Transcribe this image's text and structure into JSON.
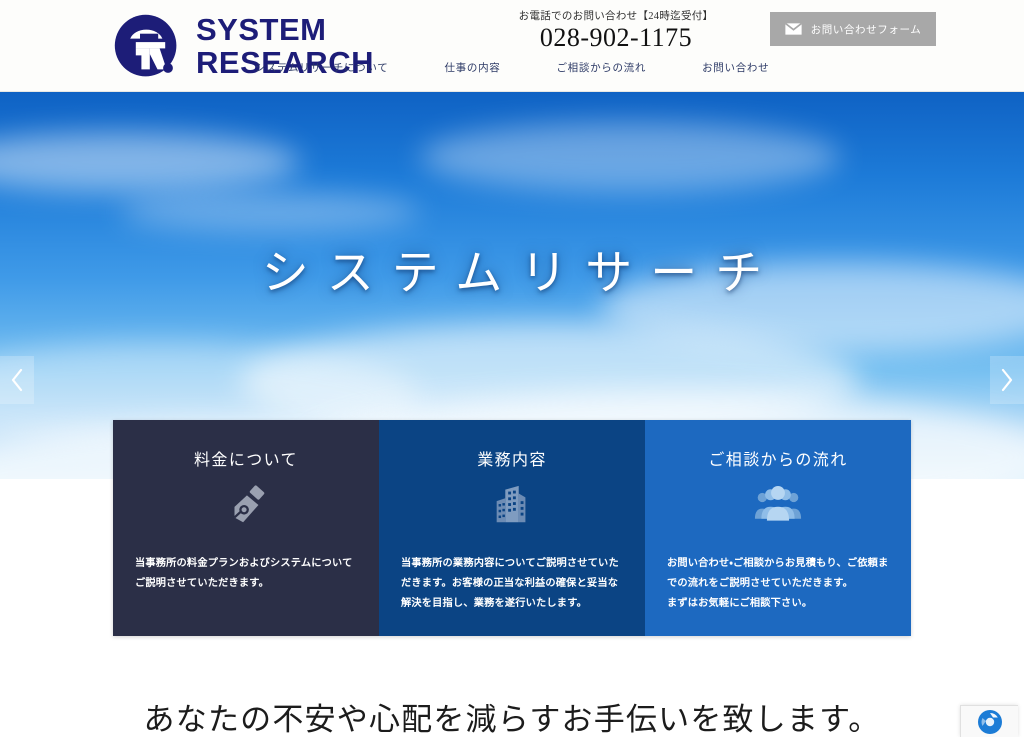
{
  "site": {
    "logo_line1": "SYSTEM",
    "logo_line2": "RESEARCH",
    "logo_icon": "sr-monogram-icon"
  },
  "header": {
    "contact_label": "お電話でのお問い合わせ【24時迄受付】",
    "phone": "028-902-1175",
    "contact_button": "お問い合わせフォーム",
    "mail_icon": "envelope-icon",
    "nav": [
      {
        "label": "システムリサーチについて"
      },
      {
        "label": "仕事の内容"
      },
      {
        "label": "ご相談からの流れ"
      },
      {
        "label": "お問い合わせ"
      }
    ]
  },
  "hero": {
    "title": "システムリサーチ",
    "prev_icon": "chevron-left-icon",
    "next_icon": "chevron-right-icon"
  },
  "cards": [
    {
      "title": "料金について",
      "icon": "fountain-pen-nib-icon",
      "body": "当事務所の料金プランおよびシステムについてご説明させていただきます。",
      "color": "#2b2f47"
    },
    {
      "title": "業務内容",
      "icon": "office-building-icon",
      "body": "当事務所の業務内容についてご説明させていただきます。お客様の正当な利益の確保と妥当な解決を目指し、業務を遂行いたします。",
      "color": "#0b4484"
    },
    {
      "title": "ご相談からの流れ",
      "icon": "people-group-icon",
      "body": "お問い合わせ・ご相談からお見積もり、ご依頼までの流れをご説明させていただきます。<br>まずはお気軽にご相談下さい。",
      "color": "#1d69c0"
    }
  ],
  "tagline": "あなたの不安や心配を減らすお手伝いを致します。",
  "badge": {
    "icon": "recaptcha-icon"
  },
  "colors": {
    "brand_navy": "#1d1d78",
    "card_dark": "#2b2f47",
    "card_mid": "#0b4484",
    "card_light": "#1d69c0",
    "button_gray": "#a8a8a8"
  }
}
